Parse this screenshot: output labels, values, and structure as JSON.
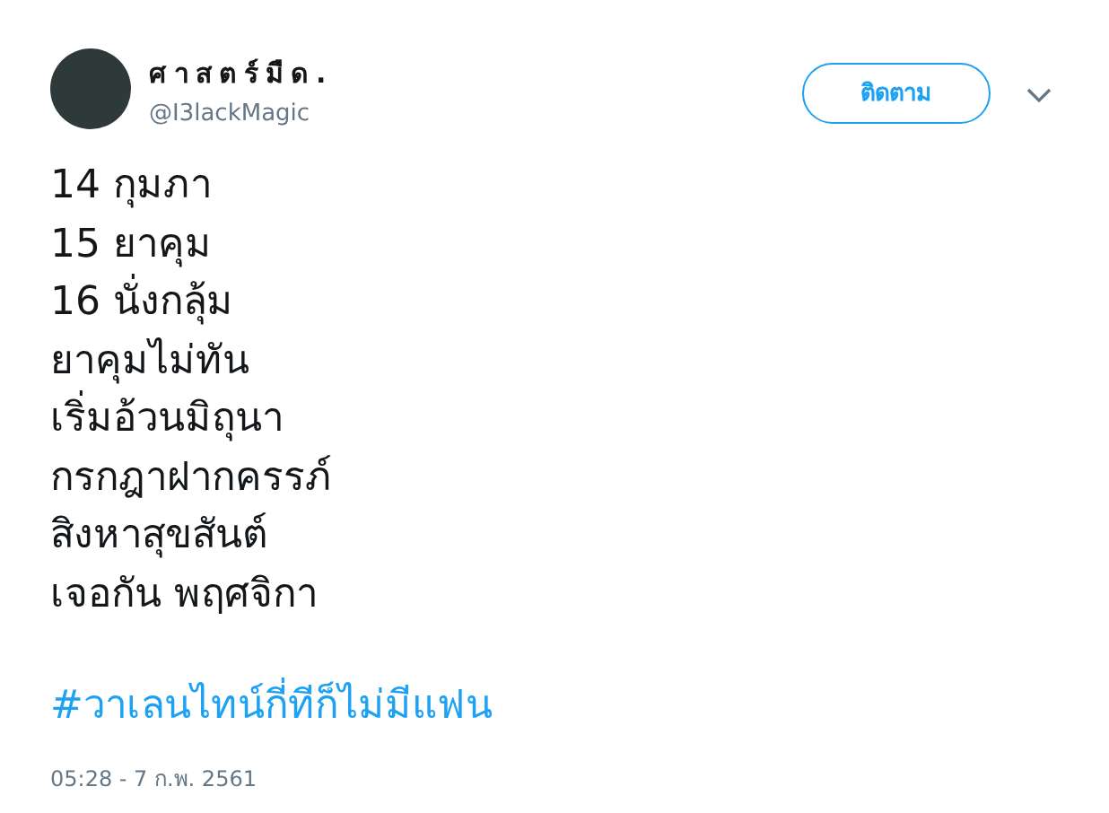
{
  "author": {
    "display_name": "ศาสตร์มืด.",
    "handle": "@I3lackMagic"
  },
  "follow_button": {
    "label": "ติดตาม"
  },
  "tweet": {
    "lines": [
      "14 กุมภา",
      "15 ยาคุม",
      "16 นั่งกลุ้ม",
      "ยาคุมไม่ทัน",
      "เริ่มอ้วนมิถุนา",
      "กรกฎาฝากครรภ์",
      "สิงหาสุขสันต์",
      "เจอกัน พฤศจิกา"
    ],
    "hashtag": "#วาเลนไทน์กี่ทีก็ไม่มีแฟน"
  },
  "timestamp": "05:28 - 7 ก.พ. 2561"
}
